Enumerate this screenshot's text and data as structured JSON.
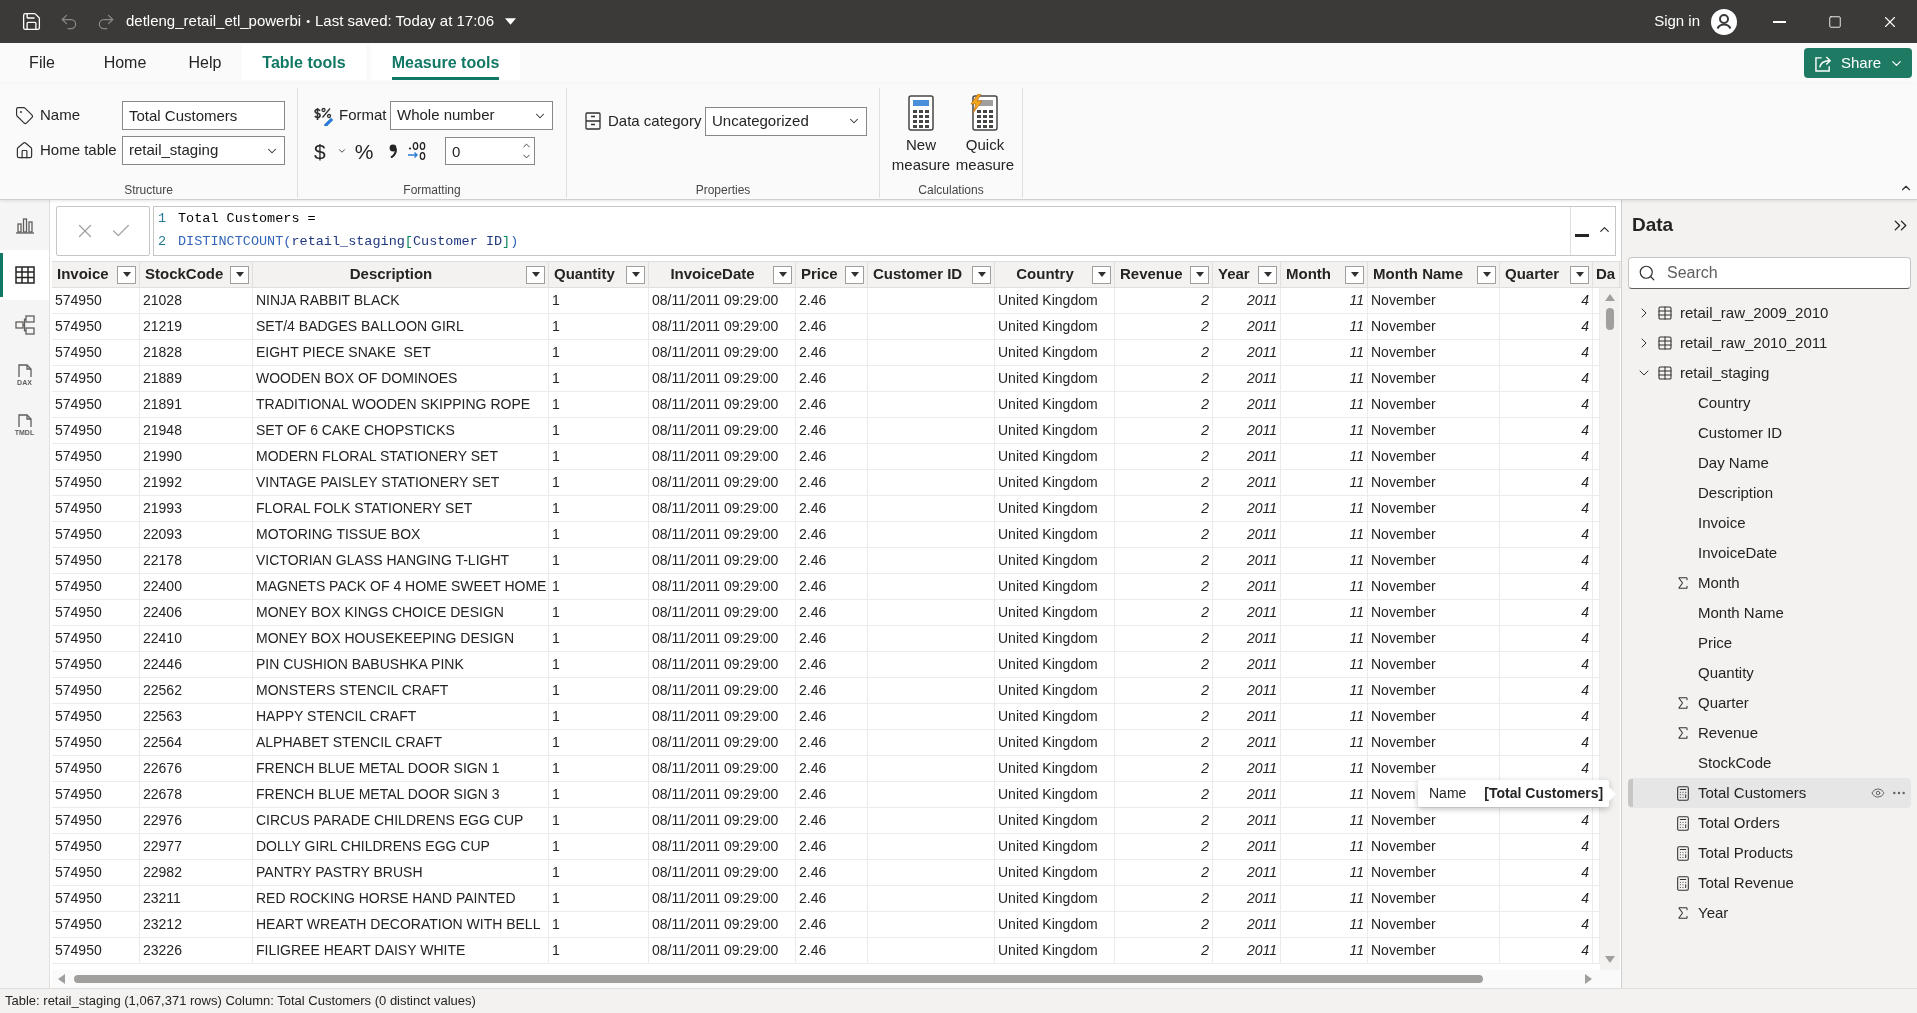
{
  "title_bar": {
    "file_name": "detleng_retail_etl_powerbi",
    "separator": "•",
    "save_status": "Last saved: Today at 17:06",
    "sign_in": "Sign in",
    "undo": {
      "disabled": true
    },
    "redo": {
      "disabled": true
    }
  },
  "ribbon_tabs": [
    {
      "label": "File",
      "kind": "plain",
      "selected": false
    },
    {
      "label": "Home",
      "kind": "plain",
      "selected": false
    },
    {
      "label": "Help",
      "kind": "plain",
      "selected": false
    },
    {
      "label": "Table tools",
      "kind": "contextual",
      "selected": false
    },
    {
      "label": "Measure tools",
      "kind": "contextual",
      "selected": true
    }
  ],
  "share_button": {
    "label": "Share"
  },
  "ribbon": {
    "structure": {
      "group_label": "Structure",
      "name": {
        "label": "Name",
        "value": "Total Customers"
      },
      "home_table": {
        "label": "Home table",
        "value": "retail_staging"
      }
    },
    "formatting": {
      "group_label": "Formatting",
      "format": {
        "label": "Format",
        "value": "Whole number"
      },
      "currency_glyph": "$",
      "percent_glyph": "%",
      "decimal_places": "0"
    },
    "properties": {
      "group_label": "Properties",
      "data_category": {
        "label": "Data category",
        "value": "Uncategorized"
      }
    },
    "calculations": {
      "group_label": "Calculations",
      "buttons": [
        {
          "kind": "new_measure",
          "label": "New measure"
        },
        {
          "kind": "quick_measure",
          "label": "Quick measure"
        }
      ]
    }
  },
  "view_rail": [
    {
      "kind": "report",
      "selected": false
    },
    {
      "kind": "table",
      "selected": true
    },
    {
      "kind": "model",
      "selected": false
    },
    {
      "kind": "dax",
      "selected": false,
      "badge": "DAX"
    },
    {
      "kind": "tmdl",
      "selected": false,
      "badge": "TMDL"
    }
  ],
  "formula_bar": {
    "lines": [
      {
        "number": "1",
        "tokens": [
          {
            "text": "Total Customers =",
            "kind": "plain"
          }
        ]
      },
      {
        "number": "2",
        "tokens": [
          {
            "text": "DISTINCTCOUNT",
            "kind": "function"
          },
          {
            "text": "(",
            "kind": "paren"
          },
          {
            "text": "retail_staging",
            "kind": "table"
          },
          {
            "text": "[",
            "kind": "bracket"
          },
          {
            "text": "Customer ID",
            "kind": "column"
          },
          {
            "text": "]",
            "kind": "bracket"
          },
          {
            "text": ")",
            "kind": "paren"
          }
        ]
      }
    ]
  },
  "table": {
    "columns": [
      {
        "name": "Invoice",
        "kind": "text"
      },
      {
        "name": "StockCode",
        "kind": "text"
      },
      {
        "name": "Description",
        "kind": "text"
      },
      {
        "name": "Quantity",
        "kind": "text"
      },
      {
        "name": "InvoiceDate",
        "kind": "text"
      },
      {
        "name": "Price",
        "kind": "text"
      },
      {
        "name": "Customer ID",
        "kind": "text"
      },
      {
        "name": "Country",
        "kind": "text"
      },
      {
        "name": "Revenue",
        "kind": "number"
      },
      {
        "name": "Year",
        "kind": "number"
      },
      {
        "name": "Month",
        "kind": "number"
      },
      {
        "name": "Month Name",
        "kind": "text"
      },
      {
        "name": "Quarter",
        "kind": "number"
      },
      {
        "name": "Da",
        "kind": "text"
      }
    ],
    "rows": [
      {
        "invoice": "574950",
        "stock_code": "21028",
        "description": "NINJA RABBIT BLACK",
        "quantity": "1",
        "invoice_date": "08/11/2011 09:29:00",
        "price": "2.46",
        "country": "United Kingdom",
        "revenue": "2",
        "year": "2011",
        "month": "11",
        "month_name": "November",
        "quarter": "4"
      },
      {
        "invoice": "574950",
        "stock_code": "21219",
        "description": "SET/4 BADGES BALLOON GIRL",
        "quantity": "1",
        "invoice_date": "08/11/2011 09:29:00",
        "price": "2.46",
        "country": "United Kingdom",
        "revenue": "2",
        "year": "2011",
        "month": "11",
        "month_name": "November",
        "quarter": "4"
      },
      {
        "invoice": "574950",
        "stock_code": "21828",
        "description": "EIGHT PIECE SNAKE  SET",
        "quantity": "1",
        "invoice_date": "08/11/2011 09:29:00",
        "price": "2.46",
        "country": "United Kingdom",
        "revenue": "2",
        "year": "2011",
        "month": "11",
        "month_name": "November",
        "quarter": "4"
      },
      {
        "invoice": "574950",
        "stock_code": "21889",
        "description": "WOODEN BOX OF DOMINOES",
        "quantity": "1",
        "invoice_date": "08/11/2011 09:29:00",
        "price": "2.46",
        "country": "United Kingdom",
        "revenue": "2",
        "year": "2011",
        "month": "11",
        "month_name": "November",
        "quarter": "4"
      },
      {
        "invoice": "574950",
        "stock_code": "21891",
        "description": "TRADITIONAL WOODEN SKIPPING ROPE",
        "quantity": "1",
        "invoice_date": "08/11/2011 09:29:00",
        "price": "2.46",
        "country": "United Kingdom",
        "revenue": "2",
        "year": "2011",
        "month": "11",
        "month_name": "November",
        "quarter": "4"
      },
      {
        "invoice": "574950",
        "stock_code": "21948",
        "description": "SET OF 6 CAKE CHOPSTICKS",
        "quantity": "1",
        "invoice_date": "08/11/2011 09:29:00",
        "price": "2.46",
        "country": "United Kingdom",
        "revenue": "2",
        "year": "2011",
        "month": "11",
        "month_name": "November",
        "quarter": "4"
      },
      {
        "invoice": "574950",
        "stock_code": "21990",
        "description": "MODERN FLORAL STATIONERY SET",
        "quantity": "1",
        "invoice_date": "08/11/2011 09:29:00",
        "price": "2.46",
        "country": "United Kingdom",
        "revenue": "2",
        "year": "2011",
        "month": "11",
        "month_name": "November",
        "quarter": "4"
      },
      {
        "invoice": "574950",
        "stock_code": "21992",
        "description": "VINTAGE PAISLEY STATIONERY SET",
        "quantity": "1",
        "invoice_date": "08/11/2011 09:29:00",
        "price": "2.46",
        "country": "United Kingdom",
        "revenue": "2",
        "year": "2011",
        "month": "11",
        "month_name": "November",
        "quarter": "4"
      },
      {
        "invoice": "574950",
        "stock_code": "21993",
        "description": "FLORAL FOLK STATIONERY SET",
        "quantity": "1",
        "invoice_date": "08/11/2011 09:29:00",
        "price": "2.46",
        "country": "United Kingdom",
        "revenue": "2",
        "year": "2011",
        "month": "11",
        "month_name": "November",
        "quarter": "4"
      },
      {
        "invoice": "574950",
        "stock_code": "22093",
        "description": "MOTORING TISSUE BOX",
        "quantity": "1",
        "invoice_date": "08/11/2011 09:29:00",
        "price": "2.46",
        "country": "United Kingdom",
        "revenue": "2",
        "year": "2011",
        "month": "11",
        "month_name": "November",
        "quarter": "4"
      },
      {
        "invoice": "574950",
        "stock_code": "22178",
        "description": "VICTORIAN GLASS HANGING T-LIGHT",
        "quantity": "1",
        "invoice_date": "08/11/2011 09:29:00",
        "price": "2.46",
        "country": "United Kingdom",
        "revenue": "2",
        "year": "2011",
        "month": "11",
        "month_name": "November",
        "quarter": "4"
      },
      {
        "invoice": "574950",
        "stock_code": "22400",
        "description": "MAGNETS PACK OF 4 HOME SWEET HOME",
        "quantity": "1",
        "invoice_date": "08/11/2011 09:29:00",
        "price": "2.46",
        "country": "United Kingdom",
        "revenue": "2",
        "year": "2011",
        "month": "11",
        "month_name": "November",
        "quarter": "4"
      },
      {
        "invoice": "574950",
        "stock_code": "22406",
        "description": "MONEY BOX KINGS CHOICE DESIGN",
        "quantity": "1",
        "invoice_date": "08/11/2011 09:29:00",
        "price": "2.46",
        "country": "United Kingdom",
        "revenue": "2",
        "year": "2011",
        "month": "11",
        "month_name": "November",
        "quarter": "4"
      },
      {
        "invoice": "574950",
        "stock_code": "22410",
        "description": "MONEY BOX HOUSEKEEPING DESIGN",
        "quantity": "1",
        "invoice_date": "08/11/2011 09:29:00",
        "price": "2.46",
        "country": "United Kingdom",
        "revenue": "2",
        "year": "2011",
        "month": "11",
        "month_name": "November",
        "quarter": "4"
      },
      {
        "invoice": "574950",
        "stock_code": "22446",
        "description": "PIN CUSHION BABUSHKA PINK",
        "quantity": "1",
        "invoice_date": "08/11/2011 09:29:00",
        "price": "2.46",
        "country": "United Kingdom",
        "revenue": "2",
        "year": "2011",
        "month": "11",
        "month_name": "November",
        "quarter": "4"
      },
      {
        "invoice": "574950",
        "stock_code": "22562",
        "description": "MONSTERS STENCIL CRAFT",
        "quantity": "1",
        "invoice_date": "08/11/2011 09:29:00",
        "price": "2.46",
        "country": "United Kingdom",
        "revenue": "2",
        "year": "2011",
        "month": "11",
        "month_name": "November",
        "quarter": "4"
      },
      {
        "invoice": "574950",
        "stock_code": "22563",
        "description": "HAPPY STENCIL CRAFT",
        "quantity": "1",
        "invoice_date": "08/11/2011 09:29:00",
        "price": "2.46",
        "country": "United Kingdom",
        "revenue": "2",
        "year": "2011",
        "month": "11",
        "month_name": "November",
        "quarter": "4"
      },
      {
        "invoice": "574950",
        "stock_code": "22564",
        "description": "ALPHABET STENCIL CRAFT",
        "quantity": "1",
        "invoice_date": "08/11/2011 09:29:00",
        "price": "2.46",
        "country": "United Kingdom",
        "revenue": "2",
        "year": "2011",
        "month": "11",
        "month_name": "November",
        "quarter": "4"
      },
      {
        "invoice": "574950",
        "stock_code": "22676",
        "description": "FRENCH BLUE METAL DOOR SIGN 1",
        "quantity": "1",
        "invoice_date": "08/11/2011 09:29:00",
        "price": "2.46",
        "country": "United Kingdom",
        "revenue": "2",
        "year": "2011",
        "month": "11",
        "month_name": "November",
        "quarter": "4"
      },
      {
        "invoice": "574950",
        "stock_code": "22678",
        "description": "FRENCH BLUE METAL DOOR SIGN 3",
        "quantity": "1",
        "invoice_date": "08/11/2011 09:29:00",
        "price": "2.46",
        "country": "United Kingdom",
        "revenue": "2",
        "year": "2011",
        "month": "11",
        "month_name": "Novem"
      },
      {
        "invoice": "574950",
        "stock_code": "22976",
        "description": "CIRCUS PARADE CHILDRENS EGG CUP",
        "quantity": "1",
        "invoice_date": "08/11/2011 09:29:00",
        "price": "2.46",
        "country": "United Kingdom",
        "revenue": "2",
        "year": "2011",
        "month": "11",
        "month_name": "November",
        "quarter": "4"
      },
      {
        "invoice": "574950",
        "stock_code": "22977",
        "description": "DOLLY GIRL CHILDRENS EGG CUP",
        "quantity": "1",
        "invoice_date": "08/11/2011 09:29:00",
        "price": "2.46",
        "country": "United Kingdom",
        "revenue": "2",
        "year": "2011",
        "month": "11",
        "month_name": "November",
        "quarter": "4"
      },
      {
        "invoice": "574950",
        "stock_code": "22982",
        "description": "PANTRY PASTRY BRUSH",
        "quantity": "1",
        "invoice_date": "08/11/2011 09:29:00",
        "price": "2.46",
        "country": "United Kingdom",
        "revenue": "2",
        "year": "2011",
        "month": "11",
        "month_name": "November",
        "quarter": "4"
      },
      {
        "invoice": "574950",
        "stock_code": "23211",
        "description": "RED ROCKING HORSE HAND PAINTED",
        "quantity": "1",
        "invoice_date": "08/11/2011 09:29:00",
        "price": "2.46",
        "country": "United Kingdom",
        "revenue": "2",
        "year": "2011",
        "month": "11",
        "month_name": "November",
        "quarter": "4"
      },
      {
        "invoice": "574950",
        "stock_code": "23212",
        "description": "HEART WREATH DECORATION WITH BELL",
        "quantity": "1",
        "invoice_date": "08/11/2011 09:29:00",
        "price": "2.46",
        "country": "United Kingdom",
        "revenue": "2",
        "year": "2011",
        "month": "11",
        "month_name": "November",
        "quarter": "4"
      },
      {
        "invoice": "574950",
        "stock_code": "23226",
        "description": "FILIGREE HEART DAISY WHITE",
        "quantity": "1",
        "invoice_date": "08/11/2011 09:29:00",
        "price": "2.46",
        "country": "United Kingdom",
        "revenue": "2",
        "year": "2011",
        "month": "11",
        "month_name": "November",
        "quarter": "4"
      }
    ]
  },
  "tooltip": {
    "label": "Name",
    "value": "[Total Customers]"
  },
  "data_pane": {
    "title": "Data",
    "search": {
      "placeholder": "Search"
    },
    "tables": [
      {
        "name": "retail_raw_2009_2010",
        "expanded": false
      },
      {
        "name": "retail_raw_2010_2011",
        "expanded": false
      },
      {
        "name": "retail_staging",
        "expanded": true,
        "children": [
          {
            "name": "Country",
            "kind": "field",
            "selected": false
          },
          {
            "name": "Customer ID",
            "kind": "field",
            "selected": false
          },
          {
            "name": "Day Name",
            "kind": "field",
            "selected": false
          },
          {
            "name": "Description",
            "kind": "field",
            "selected": false
          },
          {
            "name": "Invoice",
            "kind": "field",
            "selected": false
          },
          {
            "name": "InvoiceDate",
            "kind": "field",
            "selected": false
          },
          {
            "name": "Month",
            "kind": "sum",
            "selected": false
          },
          {
            "name": "Month Name",
            "kind": "field",
            "selected": false
          },
          {
            "name": "Price",
            "kind": "field",
            "selected": false
          },
          {
            "name": "Quantity",
            "kind": "field",
            "selected": false
          },
          {
            "name": "Quarter",
            "kind": "sum",
            "selected": false
          },
          {
            "name": "Revenue",
            "kind": "sum",
            "selected": false
          },
          {
            "name": "StockCode",
            "kind": "field",
            "selected": false
          },
          {
            "name": "Total Customers",
            "kind": "measure",
            "selected": true
          },
          {
            "name": "Total Orders",
            "kind": "measure",
            "selected": false
          },
          {
            "name": "Total Products",
            "kind": "measure",
            "selected": false
          },
          {
            "name": "Total Revenue",
            "kind": "measure",
            "selected": false
          },
          {
            "name": "Year",
            "kind": "sum",
            "selected": false
          }
        ]
      }
    ]
  },
  "status_bar": {
    "text": "Table: retail_staging (1,067,371 rows) Column: Total Customers (0 distinct values)"
  }
}
